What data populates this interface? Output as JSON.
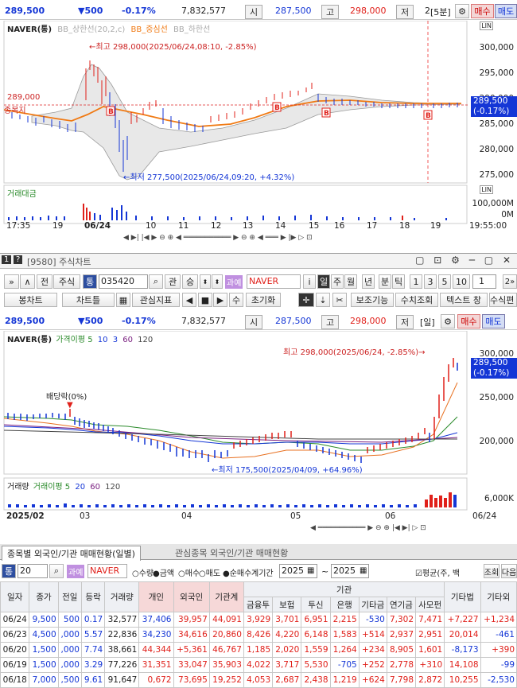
{
  "top_quote": {
    "price": "289,500",
    "change": "▼500",
    "pct": "-0.17%",
    "volume": "7,832,577",
    "open_label": "시",
    "open": "287,500",
    "high_label": "고",
    "high": "298,000",
    "low_label": "저",
    "low": "2",
    "interval": "[5분]",
    "buy": "매수",
    "sell": "매도"
  },
  "top_chart": {
    "legend_name": "NAVER(통)",
    "legend_items": [
      "BB_상한선(20,2,c)",
      "BB_중심선",
      "BB_하한선"
    ],
    "price_axis": [
      "300,000",
      "295,000",
      "290,000",
      "285,000",
      "280,000",
      "275,000"
    ],
    "current_price": "289,500",
    "current_pct": "(-0.17%)",
    "max_annot": "←최고 298,000(2025/06/24,08:10, -2.85%)",
    "min_annot": "←최저 277,500(2025/06/24,09:20, +4.32%)",
    "left_price": "289,000",
    "left_label": "종목지",
    "vol_label": "거래대금",
    "vol_axis": [
      "100,000M",
      "0M"
    ],
    "time_axis": [
      "17:35",
      "19",
      "06/24",
      "10",
      "11",
      "12",
      "13",
      "14",
      "15",
      "16",
      "17",
      "18",
      "19",
      "19:55:00"
    ],
    "markers": [
      "B",
      "B",
      "B",
      "B"
    ],
    "chart_type_label": "LIN",
    "corner_label": "LIN"
  },
  "window": {
    "title": "[9580] 주식차트",
    "num": "1",
    "help": "?"
  },
  "toolbar1": {
    "btns": [
      "»",
      "∧",
      "전",
      "주식"
    ],
    "tong": "통",
    "code": "035420",
    "gwan": "관",
    "seung": "승",
    "tax": "과예",
    "name": "NAVER",
    "i": "i",
    "periods": [
      "일",
      "주",
      "월",
      "년",
      "분",
      "틱"
    ],
    "nums": [
      "1",
      "3",
      "5",
      "10"
    ],
    "input": "1",
    "extra": "2»"
  },
  "toolbar2": {
    "btns": [
      "봉차트",
      "차트틀",
      "관심지표",
      "수",
      "초기화",
      "보조기능",
      "수치조회",
      "텍스트 창",
      "수식편"
    ]
  },
  "mid_quote": {
    "price": "289,500",
    "change": "▼500",
    "pct": "-0.17%",
    "volume": "7,832,577",
    "open_label": "시",
    "open": "287,500",
    "high_label": "고",
    "high": "298,000",
    "low_label": "저",
    "interval": "[일]",
    "buy": "매수",
    "sell": "매도"
  },
  "mid_chart": {
    "legend_name": "NAVER(통)",
    "legend_ma": "가격이평 5",
    "legend_items": [
      "10",
      "3",
      "60",
      "120"
    ],
    "price_axis": [
      "300,000",
      "250,000",
      "200,000"
    ],
    "current_price": "289,500",
    "current_pct": "(-0.17%)",
    "max_annot": "최고 298,000(2025/06/24, -2.85%)→",
    "min_annot": "←최저 175,500(2025/04/09, +64.96%)",
    "div_annot": "배당락(0%)",
    "vol_label": "거래량",
    "vol_ma": "거래이평 5",
    "vol_items": [
      "20",
      "60",
      "120"
    ],
    "vol_axis": "6,000K",
    "date_axis": [
      "2025/02",
      "03",
      "04",
      "05",
      "06",
      "06/24"
    ]
  },
  "bottom_tabs": [
    "종목별 외국인/기관 매매현황(일별)",
    "관심종목 외국인/기관 매매현황"
  ],
  "bottom_toolbar": {
    "tong": "통",
    "count": "20",
    "tax": "과예",
    "name": "NAVER",
    "radios": [
      "수량",
      "금액",
      "매수",
      "매도",
      "순매수"
    ],
    "period_label": "계기간",
    "from": "2025",
    "tilde": "~",
    "to": "2025",
    "avg": "평균",
    "avg_note": "(주, 백",
    "jo": "조회",
    "next": "다음"
  },
  "table": {
    "header_top": "기관",
    "headers": [
      "일자",
      "종가",
      "전일",
      "등락",
      "거래량",
      "개인",
      "외국인",
      "기관계",
      "금융투",
      "보험",
      "투신",
      "은행",
      "기타금",
      "연기금",
      "사모펀",
      "기타법",
      "기타외"
    ],
    "rows": [
      [
        "06/24",
        "9,500",
        "500",
        "0.17",
        "32,577",
        "37,406",
        "39,957",
        "44,091",
        "3,929",
        "3,701",
        "6,951",
        "2,215",
        "-530",
        "7,302",
        "7,471",
        "+7,227",
        "+1,234"
      ],
      [
        "06/23",
        "4,500",
        ",000",
        "5.57",
        "22,836",
        "34,230",
        "34,616",
        "20,860",
        "8,426",
        "4,220",
        "6,148",
        "1,583",
        "+514",
        "2,937",
        "2,951",
        "20,014",
        "-461"
      ],
      [
        "06/20",
        "1,500",
        ",000",
        "7.74",
        "38,661",
        "44,344",
        "+5,361",
        "46,767",
        "1,185",
        "2,020",
        "1,559",
        "1,264",
        "+234",
        "8,905",
        "1,601",
        "-8,173",
        "+390"
      ],
      [
        "06/19",
        "1,500",
        ",000",
        "3.29",
        "77,226",
        "31,351",
        "33,047",
        "35,903",
        "4,022",
        "3,717",
        "5,530",
        "-705",
        "+252",
        "2,778",
        "+310",
        "14,108",
        "-99"
      ],
      [
        "06/18",
        "7,000",
        ",500",
        "9.61",
        "91,647",
        "0,672",
        "73,695",
        "19,252",
        "4,053",
        "2,687",
        "2,438",
        "1,219",
        "+624",
        "7,798",
        "2,872",
        "10,255",
        "-2,530"
      ]
    ]
  }
}
